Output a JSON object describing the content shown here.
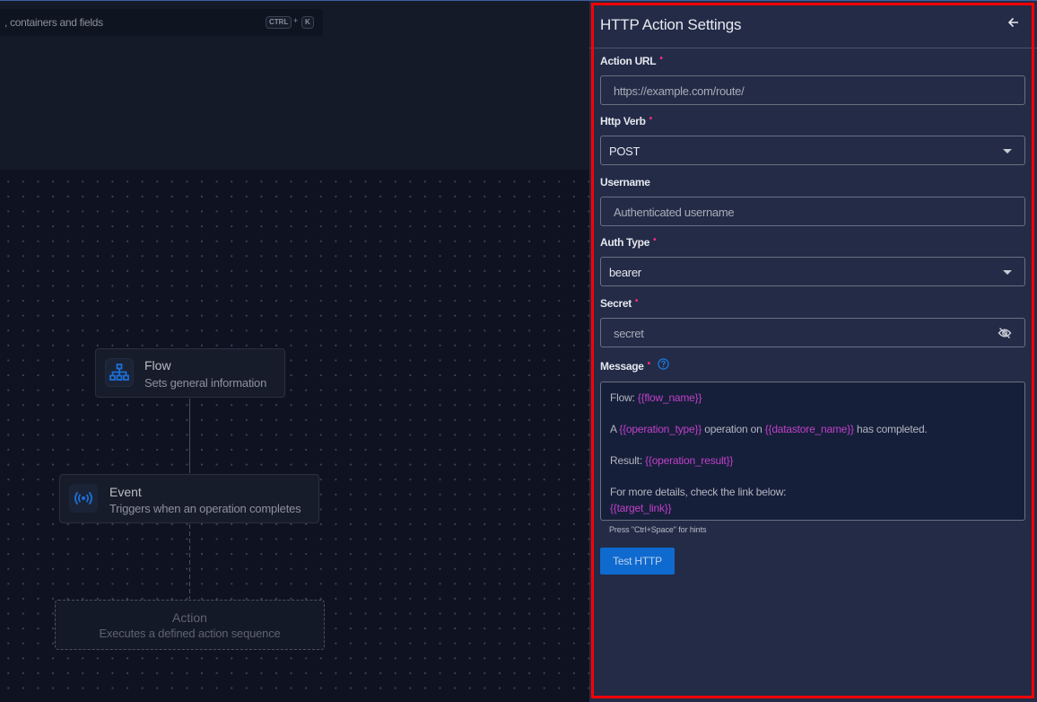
{
  "search": {
    "placeholder_visible": ", containers and fields",
    "shortcut_ctrl": "CTRL",
    "shortcut_plus": "+",
    "shortcut_key": "K"
  },
  "canvas": {
    "nodes": [
      {
        "title": "Flow",
        "description": "Sets general information",
        "icon": "sitemap-icon",
        "state": "configured"
      },
      {
        "title": "Event",
        "description": "Triggers when an operation completes",
        "icon": "broadcast-icon",
        "state": "configured"
      },
      {
        "title": "Action",
        "description": "Executes a defined action sequence",
        "icon": null,
        "state": "placeholder"
      }
    ]
  },
  "panel": {
    "title": "HTTP Action Settings",
    "back_icon": "arrow-left-icon",
    "fields": {
      "action_url": {
        "label": "Action URL",
        "required": "•",
        "placeholder": "https://example.com/route/"
      },
      "http_verb": {
        "label": "Http Verb",
        "required": "•",
        "value": "POST"
      },
      "username": {
        "label": "Username",
        "placeholder": "Authenticated username"
      },
      "auth_type": {
        "label": "Auth Type",
        "required": "•",
        "value": "bearer"
      },
      "secret": {
        "label": "Secret",
        "required": "•",
        "placeholder": "secret",
        "toggle_icon": "eye-off-icon"
      },
      "message": {
        "label": "Message",
        "required": "•",
        "help_icon": "question-circle-icon",
        "lines": {
          "l1_text": "Flow: ",
          "l1_var": "{{flow_name}}",
          "l3_a": "A ",
          "l3_var1": "{{operation_type}}",
          "l3_b": " operation on ",
          "l3_var2": "{{datastore_name}}",
          "l3_c": " has completed.",
          "l5_text": "Result: ",
          "l5_var": "{{operation_result}}",
          "l7_text": "For more details, check the link below:",
          "l8_var": "{{target_link}}"
        },
        "hint": "Press \"Ctrl+Space\" for hints"
      }
    },
    "test_button": "Test HTTP"
  },
  "colors": {
    "accent": "#0f6ad0",
    "required": "#ff2d7a",
    "template_var": "#c040c8",
    "highlight_border": "#ff0000",
    "panel_bg": "#232b47",
    "canvas_bg": "#0f1321"
  }
}
